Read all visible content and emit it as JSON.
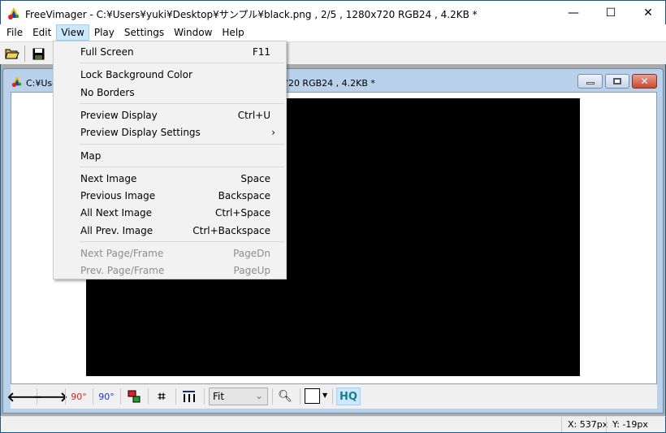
{
  "window": {
    "title": "FreeVimager - C:¥Users¥yuki¥Desktop¥サンプル¥black.png , 2/5 , 1280x720 RGB24 , 4.2KB *",
    "minimize": "—",
    "maximize": "☐",
    "close": "✕"
  },
  "menubar": [
    "File",
    "Edit",
    "View",
    "Play",
    "Settings",
    "Window",
    "Help"
  ],
  "active_menu": "View",
  "toolbar": {
    "icons": [
      "open-folder-icon",
      "save-icon"
    ]
  },
  "child": {
    "title": "C:¥Users¥yuki¥Desktop¥サンプル¥black.png , 2/5 , 1280x720 RGB24 , 4.2KB *",
    "image_color": "#000000"
  },
  "view_menu": [
    {
      "label": "Full Screen",
      "shortcut": "F11",
      "enabled": true
    },
    {
      "sep": true
    },
    {
      "label": "Lock Background Color",
      "shortcut": "",
      "enabled": true
    },
    {
      "label": "No Borders",
      "shortcut": "",
      "enabled": true
    },
    {
      "sep": true
    },
    {
      "label": "Preview Display",
      "shortcut": "Ctrl+U",
      "enabled": true
    },
    {
      "label": "Preview Display Settings",
      "shortcut": "›",
      "enabled": true
    },
    {
      "sep": true
    },
    {
      "label": "Map",
      "shortcut": "",
      "enabled": true
    },
    {
      "sep": true
    },
    {
      "label": "Next Image",
      "shortcut": "Space",
      "enabled": true
    },
    {
      "label": "Previous Image",
      "shortcut": "Backspace",
      "enabled": true
    },
    {
      "label": "All Next Image",
      "shortcut": "Ctrl+Space",
      "enabled": true
    },
    {
      "label": "All Prev. Image",
      "shortcut": "Ctrl+Backspace",
      "enabled": true
    },
    {
      "sep": true
    },
    {
      "label": "Next Page/Frame",
      "shortcut": "PageDn",
      "enabled": false
    },
    {
      "label": "Prev. Page/Frame",
      "shortcut": "PageUp",
      "enabled": false
    }
  ],
  "bottombar": {
    "rotate_left": "90°",
    "rotate_right": "90°",
    "zoom_select": "Fit",
    "hq": "HQ"
  },
  "status": {
    "x": "X: 537px",
    "y": "Y: -19px"
  }
}
